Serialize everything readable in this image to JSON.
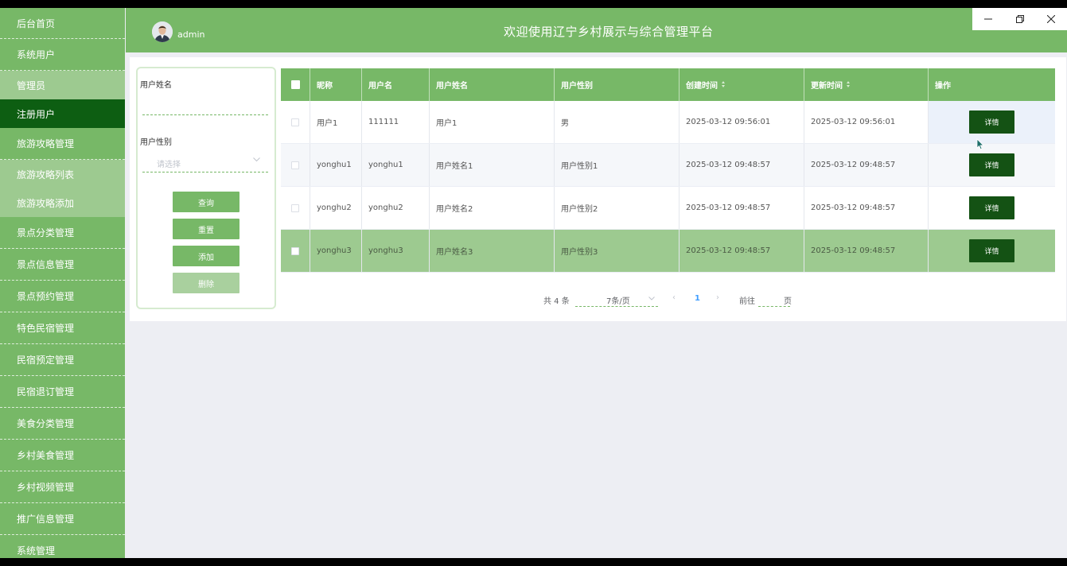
{
  "sidebar": {
    "items": [
      {
        "label": "后台首页"
      },
      {
        "label": "系统用户"
      },
      {
        "label": "管理员"
      },
      {
        "label": "注册用户"
      },
      {
        "label": "旅游攻略管理"
      },
      {
        "label": "旅游攻略列表"
      },
      {
        "label": "旅游攻略添加"
      },
      {
        "label": "景点分类管理"
      },
      {
        "label": "景点信息管理"
      },
      {
        "label": "景点预约管理"
      },
      {
        "label": "特色民宿管理"
      },
      {
        "label": "民宿预定管理"
      },
      {
        "label": "民宿退订管理"
      },
      {
        "label": "美食分类管理"
      },
      {
        "label": "乡村美食管理"
      },
      {
        "label": "乡村视频管理"
      },
      {
        "label": "推广信息管理"
      },
      {
        "label": "系统管理"
      }
    ]
  },
  "header": {
    "username": "admin",
    "title": "欢迎使用辽宁乡村展示与综合管理平台"
  },
  "search": {
    "name_label": "用户姓名",
    "name_value": "",
    "gender_label": "用户性别",
    "gender_placeholder": "请选择",
    "query_label": "查询",
    "reset_label": "重置",
    "add_label": "添加",
    "delete_label": "删除"
  },
  "table": {
    "headers": [
      "昵称",
      "用户名",
      "用户姓名",
      "用户性别",
      "创建时间",
      "更新时间",
      "操作"
    ],
    "action_label": "详情",
    "rows": [
      {
        "nickname": "用户1",
        "username": "111111",
        "realname": "用户1",
        "gender": "男",
        "created": "2025-03-12 09:56:01",
        "updated": "2025-03-12 09:56:01"
      },
      {
        "nickname": "yonghu1",
        "username": "yonghu1",
        "realname": "用户姓名1",
        "gender": "用户性别1",
        "created": "2025-03-12 09:48:57",
        "updated": "2025-03-12 09:48:57"
      },
      {
        "nickname": "yonghu2",
        "username": "yonghu2",
        "realname": "用户姓名2",
        "gender": "用户性别2",
        "created": "2025-03-12 09:48:57",
        "updated": "2025-03-12 09:48:57"
      },
      {
        "nickname": "yonghu3",
        "username": "yonghu3",
        "realname": "用户姓名3",
        "gender": "用户性别3",
        "created": "2025-03-12 09:48:57",
        "updated": "2025-03-12 09:48:57"
      }
    ]
  },
  "pagination": {
    "total": "共 4 条",
    "page_size": "7条/页",
    "current_page": "1",
    "goto_label": "前往",
    "goto_value": "",
    "page_suffix": "页"
  },
  "colors": {
    "primary": "#77b867",
    "active": "#0d5e12",
    "detail_button": "#145214",
    "highlight_row": "#9dca90"
  }
}
